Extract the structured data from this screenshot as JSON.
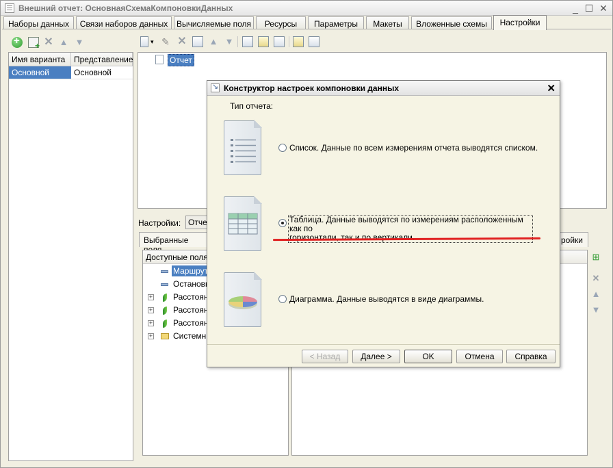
{
  "window": {
    "title": "Внешний отчет: ОсновнаяСхемаКомпоновкиДанных",
    "controls": [
      "_",
      "☐",
      "✕"
    ]
  },
  "tabs": [
    {
      "label": "Наборы данных"
    },
    {
      "label": "Связи наборов данных"
    },
    {
      "label": "Вычисляемые поля"
    },
    {
      "label": "Ресурсы"
    },
    {
      "label": "Параметры"
    },
    {
      "label": "Макеты"
    },
    {
      "label": "Вложенные схемы"
    },
    {
      "label": "Настройки"
    }
  ],
  "active_tab": "Настройки",
  "variants_table": {
    "columns": [
      "Имя варианта",
      "Представление"
    ],
    "rows": [
      [
        "Основной",
        "Основной"
      ]
    ]
  },
  "structure_tree": {
    "selected_node": "Отчет"
  },
  "settings_label": "Настройки:",
  "settings_combo_value": "Отчет",
  "subtabs": {
    "selected_fields": "Выбранные поля",
    "right_partial": "ройки"
  },
  "available_fields": {
    "header": "Доступные поля",
    "items": [
      {
        "label": "Маршрут",
        "icon": "dash-icon",
        "expandable": false,
        "selected": true
      },
      {
        "label": "Остановк",
        "icon": "dash-icon",
        "expandable": false,
        "selected": false
      },
      {
        "label": "Расстоян",
        "icon": "leaf-icon",
        "expandable": true,
        "selected": false
      },
      {
        "label": "Расстоян",
        "icon": "leaf-icon",
        "expandable": true,
        "selected": false
      },
      {
        "label": "Расстоян",
        "icon": "leaf-icon",
        "expandable": true,
        "selected": false
      },
      {
        "label": "Системны",
        "icon": "folder-icon",
        "expandable": true,
        "selected": false
      }
    ]
  },
  "dialog": {
    "title": "Конструктор настроек компоновки данных",
    "report_type_label": "Тип отчета:",
    "options": [
      {
        "label": "Список. Данные по всем измерениям отчета выводятся списком.",
        "selected": false,
        "icon": "list-doc-icon"
      },
      {
        "label_line1": "Таблица. Данные выводятся по измерениям расположенным как по",
        "label_line2": "горизонтали, так и по вертикали.",
        "selected": true,
        "icon": "table-doc-icon"
      },
      {
        "label": "Диаграмма. Данные выводятся в виде диаграммы.",
        "selected": false,
        "icon": "chart-doc-icon"
      }
    ],
    "buttons": {
      "back": "< Назад",
      "next": "Далее >",
      "ok": "OK",
      "cancel": "Отмена",
      "help": "Справка"
    }
  },
  "colors": {
    "selection": "#4a7fc1",
    "dialog_bg": "#f6f4e4",
    "annotation": "#e02020"
  }
}
